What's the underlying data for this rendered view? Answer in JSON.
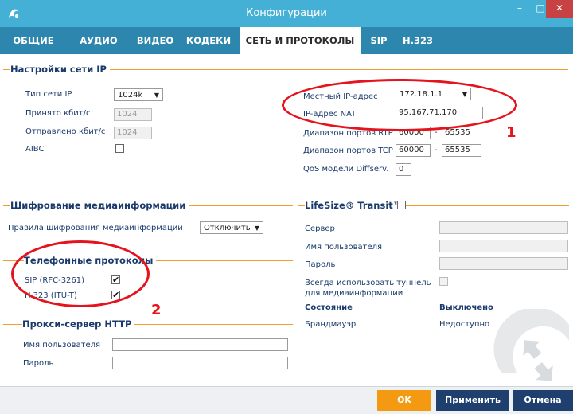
{
  "window": {
    "title": "Конфигурации",
    "minimize": "–",
    "maximize": "□",
    "close": "✕"
  },
  "tabs": [
    {
      "label": "ОБЩИЕ"
    },
    {
      "label": "АУДИО"
    },
    {
      "label": "ВИДЕО"
    },
    {
      "label": "КОДЕКИ"
    },
    {
      "label": "СЕТЬ И ПРОТОКОЛЫ"
    },
    {
      "label": "SIP"
    },
    {
      "label": "H.323"
    }
  ],
  "info_icon": "i",
  "ip_settings": {
    "title": "Настройки сети IP",
    "network_type_label": "Тип сети IP",
    "network_type_value": "1024k",
    "received_label": "Принято кбит/с",
    "received_value": "1024",
    "sent_label": "Отправлено кбит/с",
    "sent_value": "1024",
    "aibc_label": "AIBC",
    "local_ip_label": "Местный IP-адрес",
    "local_ip_value": "172.18.1.1",
    "nat_ip_label": "IP-адрес NAT",
    "nat_ip_value": "95.167.71.170",
    "rtp_label": "Диапазон портов RTP",
    "rtp_from": "60000",
    "rtp_to": "65535",
    "tcp_label": "Диапазон портов TCP",
    "tcp_from": "60000",
    "tcp_to": "65535",
    "dash": "-",
    "qos_label": "QoS модели Diffserv.",
    "qos_value": "0"
  },
  "encryption": {
    "title": "Шифрование медиаинформации",
    "rule_label": "Правила шифрования медиаинформации",
    "rule_value": "Отключить"
  },
  "phone_protocols": {
    "title": "Телефонные протоколы",
    "sip_label": "SIP (RFC-3261)",
    "sip_check": "✔",
    "h323_label": "H.323 (ITU-T)",
    "h323_check": "✔"
  },
  "proxy": {
    "title": "Прокси-сервер HTTP",
    "user_label": "Имя пользователя",
    "password_label": "Пароль"
  },
  "transit": {
    "title": "LifeSize® Transit™",
    "server_label": "Сервер",
    "user_label": "Имя пользователя",
    "password_label": "Пароль",
    "tunnel_label_1": "Всегда использовать туннель",
    "tunnel_label_2": "для медиаинформации",
    "state_label": "Состояние",
    "state_value": "Выключено",
    "firewall_label": "Брандмауэр",
    "firewall_value": "Недоступно"
  },
  "annotations": {
    "one": "1",
    "two": "2"
  },
  "footer": {
    "ok": "OK",
    "apply": "Применить",
    "cancel": "Отмена"
  },
  "colors": {
    "title_bar": "#45b0d6",
    "tabs": "#2c86ad",
    "accent_line": "#f0a02a",
    "ok_button": "#f39a12",
    "dark_button": "#1f3f6f",
    "annotation_red": "#e5131d"
  }
}
